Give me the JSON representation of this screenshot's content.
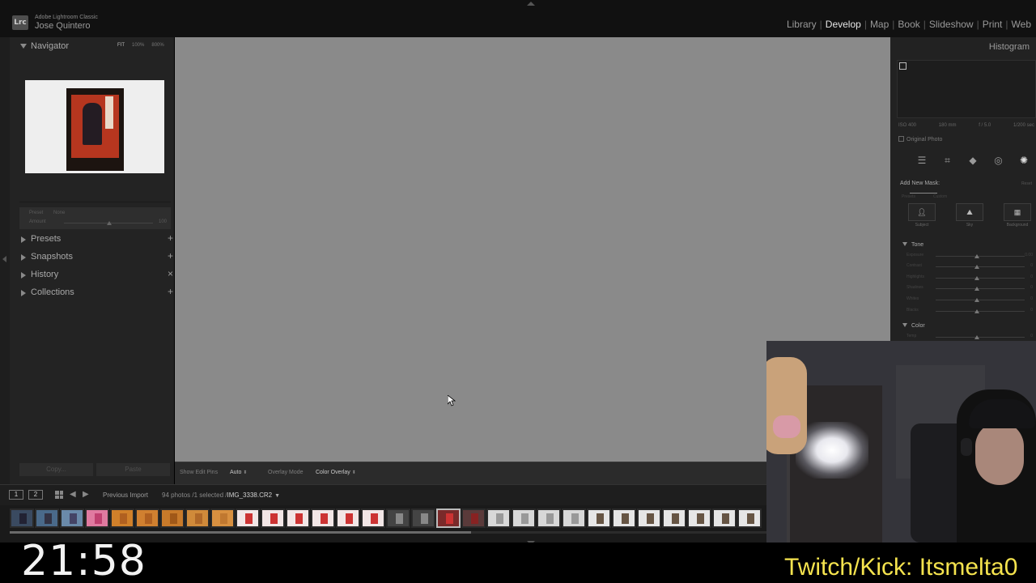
{
  "app": {
    "logo": "Lrc",
    "name": "Adobe Lightroom Classic",
    "user": "Jose Quintero"
  },
  "modules": [
    {
      "label": "Library",
      "active": false
    },
    {
      "label": "Develop",
      "active": true
    },
    {
      "label": "Map",
      "active": false
    },
    {
      "label": "Book",
      "active": false
    },
    {
      "label": "Slideshow",
      "active": false
    },
    {
      "label": "Print",
      "active": false
    },
    {
      "label": "Web",
      "active": false
    }
  ],
  "left_panel": {
    "navigator": {
      "title": "Navigator",
      "zoom_options": [
        "FIT",
        "100%",
        "800%"
      ]
    },
    "preset_line": {
      "preset_label": "Preset",
      "preset_value": "None",
      "amount_label": "Amount",
      "amount_value": "100"
    },
    "sections": [
      {
        "label": "Presets",
        "action": "+"
      },
      {
        "label": "Snapshots",
        "action": "+"
      },
      {
        "label": "History",
        "action": "×"
      },
      {
        "label": "Collections",
        "action": "+"
      }
    ],
    "copy_label": "Copy...",
    "paste_label": "Paste"
  },
  "toolbar": {
    "show_edit_pins_label": "Show Edit Pins",
    "show_edit_pins_value": "Auto",
    "overlay_mode_label": "Overlay Mode",
    "overlay_mode_value": "Color Overlay"
  },
  "right_panel": {
    "title": "Histogram",
    "exif": [
      "ISO 400",
      "180 mm",
      "f / 5.0",
      "1/200 sec"
    ],
    "original_photo_label": "Original Photo",
    "tool_icons": [
      "sliders-icon",
      "crop-icon",
      "eraser-icon",
      "redeye-icon",
      "masking-icon"
    ],
    "mask": {
      "title": "Add New Mask:",
      "reset": "Reset",
      "tabs": [
        "Presets",
        "Custom"
      ],
      "buttons": [
        {
          "label": "Subject",
          "icon": "person-icon"
        },
        {
          "label": "Sky",
          "icon": "mountain-icon"
        },
        {
          "label": "Background",
          "icon": "landscape-icon"
        }
      ]
    },
    "tone": {
      "title": "Tone",
      "sliders": [
        {
          "label": "Exposure",
          "value": "0.00"
        },
        {
          "label": "Contrast",
          "value": "0"
        },
        {
          "label": "Highlights",
          "value": "0"
        },
        {
          "label": "Shadows",
          "value": "0"
        },
        {
          "label": "Whites",
          "value": "0"
        },
        {
          "label": "Blacks",
          "value": "0"
        }
      ]
    },
    "color": {
      "title": "Color",
      "sliders": [
        {
          "label": "Temp",
          "value": "0"
        }
      ]
    }
  },
  "filmstrip": {
    "screen_buttons": [
      "1",
      "2"
    ],
    "source": "Previous Import",
    "count_text": "94 photos /1 selected /",
    "file_name": "IMG_3338.CR2",
    "thumb_count": 30,
    "selected_index": 17,
    "scroll_position": 0.61
  },
  "overlay": {
    "clock": "21:58",
    "twitch": "Twitch/Kick: Itsmelta0"
  }
}
